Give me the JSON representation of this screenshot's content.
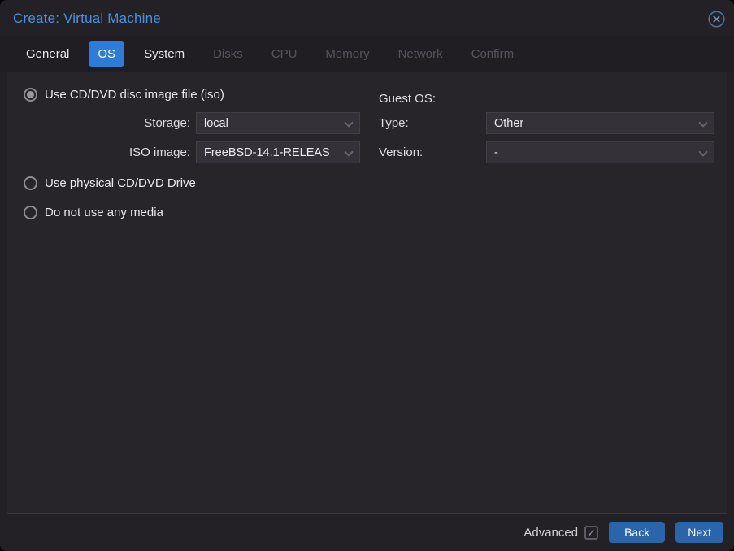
{
  "window": {
    "title": "Create: Virtual Machine",
    "close_icon": "circle-x-icon"
  },
  "tabs": [
    {
      "label": "General",
      "state": "enabled"
    },
    {
      "label": "OS",
      "state": "active"
    },
    {
      "label": "System",
      "state": "enabled"
    },
    {
      "label": "Disks",
      "state": "disabled"
    },
    {
      "label": "CPU",
      "state": "disabled"
    },
    {
      "label": "Memory",
      "state": "disabled"
    },
    {
      "label": "Network",
      "state": "disabled"
    },
    {
      "label": "Confirm",
      "state": "disabled"
    }
  ],
  "form": {
    "media": {
      "iso_radio": {
        "label": "Use CD/DVD disc image file (iso)",
        "selected": true
      },
      "storage": {
        "label": "Storage:",
        "value": "local"
      },
      "iso_image": {
        "label": "ISO image:",
        "value": "FreeBSD-14.1-RELEAS"
      },
      "physical_radio": {
        "label": "Use physical CD/DVD Drive",
        "selected": false
      },
      "no_media_radio": {
        "label": "Do not use any media",
        "selected": false
      }
    },
    "guest_os": {
      "heading": "Guest OS:",
      "type": {
        "label": "Type:",
        "value": "Other"
      },
      "version": {
        "label": "Version:",
        "value": "-"
      }
    }
  },
  "footer": {
    "advanced": {
      "label": "Advanced",
      "checked": true,
      "check_glyph": "✓"
    },
    "back_button": "Back",
    "next_button": "Next"
  },
  "colors": {
    "active_tab": "#2e7cd6",
    "button": "#2a64ab",
    "title": "#4792e4",
    "panel_bg": "#272529",
    "frame_bg": "#232126",
    "field_bg": "#343238"
  }
}
